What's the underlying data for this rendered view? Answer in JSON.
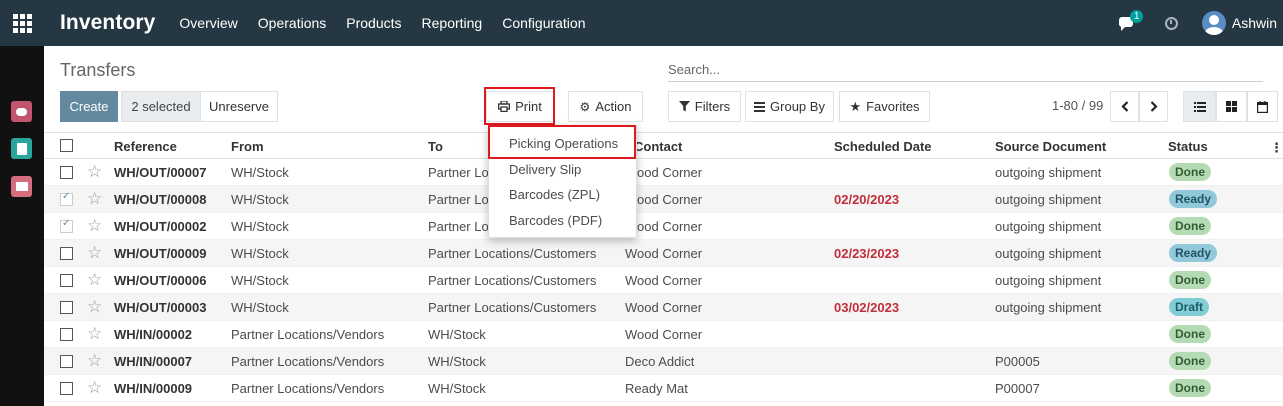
{
  "app": {
    "brand": "Inventory"
  },
  "menu": [
    "Overview",
    "Operations",
    "Products",
    "Reporting",
    "Configuration"
  ],
  "navbar": {
    "chat_badge": "1",
    "user": "Ashwin"
  },
  "page": {
    "title": "Transfers",
    "search_placeholder": "Search..."
  },
  "buttons": {
    "create": "Create",
    "selected": "2 selected",
    "unreserve": "Unreserve",
    "print": "Print",
    "action": "Action",
    "filters": "Filters",
    "group_by": "Group By",
    "favorites": "Favorites"
  },
  "pager": "1-80 / 99",
  "print_menu": [
    "Picking Operations",
    "Delivery Slip",
    "Barcodes (ZPL)",
    "Barcodes (PDF)"
  ],
  "columns": {
    "reference": "Reference",
    "from": "From",
    "to": "To",
    "contact": "Contact",
    "scheduled_date": "Scheduled Date",
    "source_document": "Source Document",
    "status": "Status"
  },
  "rows": [
    {
      "ref": "WH/OUT/00007",
      "from": "WH/Stock",
      "to": "Partner Locations/Customers",
      "contact": "Wood Corner",
      "date": "",
      "source": "outgoing shipment",
      "status": "Done",
      "checked": false
    },
    {
      "ref": "WH/OUT/00008",
      "from": "WH/Stock",
      "to": "Partner Locations/Customers",
      "contact": "Wood Corner",
      "date": "02/20/2023",
      "source": "outgoing shipment",
      "status": "Ready",
      "checked": true
    },
    {
      "ref": "WH/OUT/00002",
      "from": "WH/Stock",
      "to": "Partner Locations/Customers",
      "contact": "Wood Corner",
      "date": "",
      "source": "outgoing shipment",
      "status": "Done",
      "checked": true
    },
    {
      "ref": "WH/OUT/00009",
      "from": "WH/Stock",
      "to": "Partner Locations/Customers",
      "contact": "Wood Corner",
      "date": "02/23/2023",
      "source": "outgoing shipment",
      "status": "Ready",
      "checked": false
    },
    {
      "ref": "WH/OUT/00006",
      "from": "WH/Stock",
      "to": "Partner Locations/Customers",
      "contact": "Wood Corner",
      "date": "",
      "source": "outgoing shipment",
      "status": "Done",
      "checked": false
    },
    {
      "ref": "WH/OUT/00003",
      "from": "WH/Stock",
      "to": "Partner Locations/Customers",
      "contact": "Wood Corner",
      "date": "03/02/2023",
      "source": "outgoing shipment",
      "status": "Draft",
      "checked": false
    },
    {
      "ref": "WH/IN/00002",
      "from": "Partner Locations/Vendors",
      "to": "WH/Stock",
      "contact": "Wood Corner",
      "date": "",
      "source": "",
      "status": "Done",
      "checked": false
    },
    {
      "ref": "WH/IN/00007",
      "from": "Partner Locations/Vendors",
      "to": "WH/Stock",
      "contact": "Deco Addict",
      "date": "",
      "source": "P00005",
      "status": "Done",
      "checked": false
    },
    {
      "ref": "WH/IN/00009",
      "from": "Partner Locations/Vendors",
      "to": "WH/Stock",
      "contact": "Ready Mat",
      "date": "",
      "source": "P00007",
      "status": "Done",
      "checked": false
    }
  ],
  "colors": {
    "navbar": "#243742",
    "primary": "#6289a0",
    "highlight": "#e0191f",
    "date_red": "#c12e3a"
  }
}
